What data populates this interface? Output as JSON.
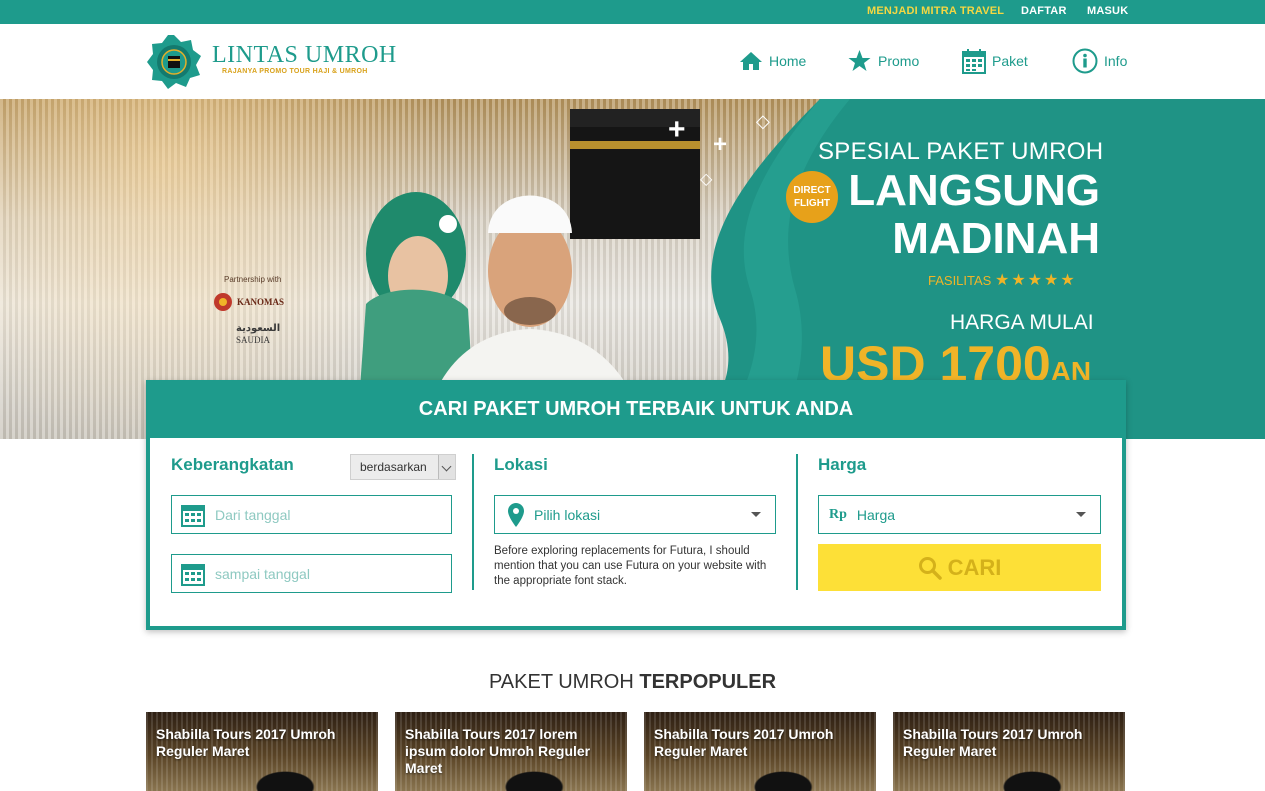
{
  "topbar": {
    "mitra": "MENJADI MITRA TRAVEL",
    "daftar": "DAFTAR",
    "masuk": "MASUK"
  },
  "logo": {
    "title": "LINTAS UMROH",
    "tagline": "RAJANYA PROMO TOUR HAJI & UMROH"
  },
  "nav": [
    {
      "label": "Home",
      "icon": "home-icon"
    },
    {
      "label": "Promo",
      "icon": "star-icon"
    },
    {
      "label": "Paket",
      "icon": "calendar-icon"
    },
    {
      "label": "Info",
      "icon": "info-icon"
    }
  ],
  "hero": {
    "partnership": "Partnership with",
    "partner1": "KANOMAS",
    "partner2": "SAUDIA",
    "partner2_arabic": "السعودية",
    "subtitle": "SPESIAL PAKET UMROH",
    "badge_line1": "DIRECT",
    "badge_line2": "FLIGHT",
    "big_line1": "LANGSUNG",
    "big_line2": "MADINAH",
    "fasilitas": "FASILITAS",
    "stars": "★★★★★",
    "harga_mulai": "HARGA MULAI",
    "price": "USD 1700",
    "price_suffix": "AN"
  },
  "search": {
    "heading": "CARI PAKET UMROH TERBAIK UNTUK ANDA",
    "keberangkatan": {
      "title": "Keberangkatan",
      "sort_select": "berdasarkan",
      "from_placeholder": "Dari tanggal",
      "to_placeholder": "sampai tanggal"
    },
    "lokasi": {
      "title": "Lokasi",
      "select_value": "Pilih lokasi",
      "note": "Before exploring replacements for Futura, I should mention that you can use Futura on your website with the appropriate font stack."
    },
    "harga": {
      "title": "Harga",
      "currency": "Rp",
      "select_value": "Harga",
      "button": "CARI"
    }
  },
  "section": {
    "title_normal": "PAKET UMROH",
    "title_bold": "TERPOPULER"
  },
  "cards": [
    {
      "title": "Shabilla Tours 2017 Umroh Reguler Maret"
    },
    {
      "title": "Shabilla Tours 2017 lorem ipsum dolor Umroh Reguler Maret"
    },
    {
      "title": "Shabilla Tours 2017 Umroh Reguler Maret"
    },
    {
      "title": "Shabilla Tours 2017 Umroh Reguler Maret"
    }
  ],
  "colors": {
    "teal": "#1e9b8c",
    "gold": "#f0b428",
    "yellow_button": "#fde037"
  }
}
